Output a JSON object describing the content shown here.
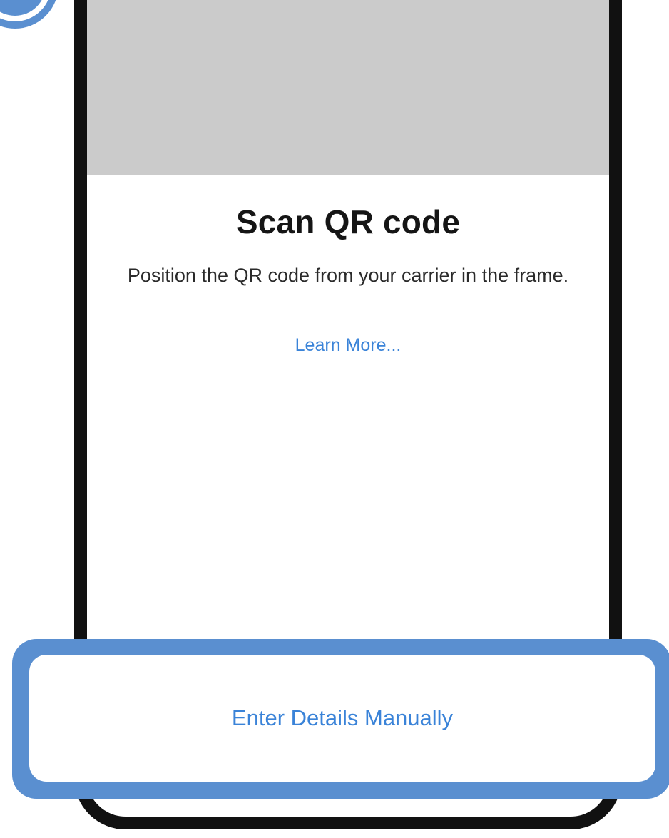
{
  "screen": {
    "title": "Scan QR code",
    "instructions": "Position the QR code from your carrier in the frame.",
    "learn_more_link": "Learn More..."
  },
  "actions": {
    "manual_entry_label": "Enter Details Manually"
  },
  "colors": {
    "accent": "#3a83d8",
    "highlight": "#5a8fd0",
    "camera_placeholder": "#cbcbcb",
    "phone_frame": "#111111"
  },
  "icons": {
    "step_marker": "step-number-circle"
  }
}
